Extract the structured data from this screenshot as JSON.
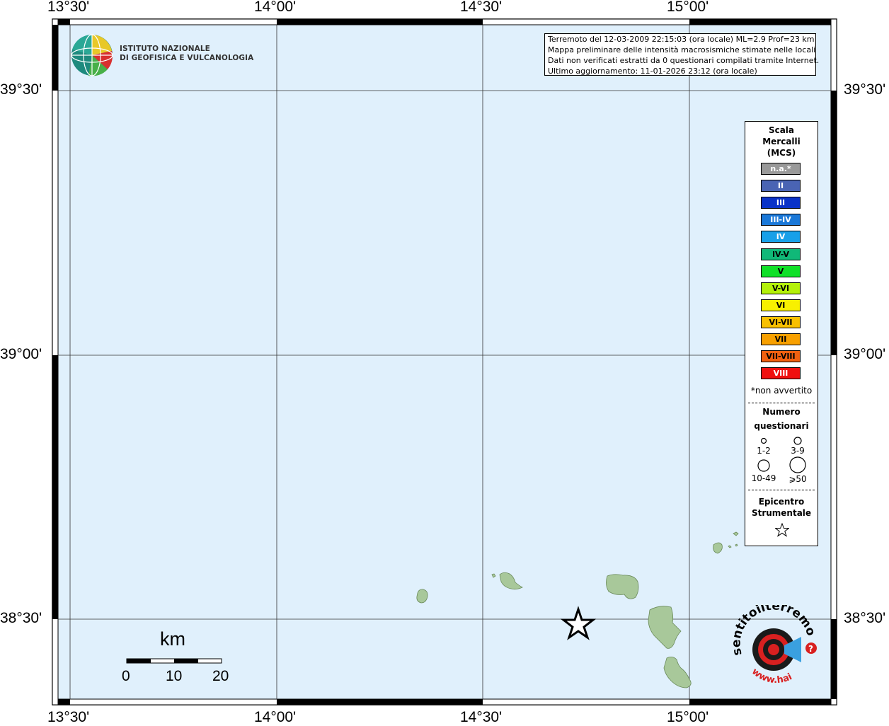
{
  "map": {
    "lon_ticks": [
      "13°30'",
      "14°00'",
      "14°30'",
      "15°00'"
    ],
    "lat_ticks": [
      "39°30'",
      "39°00'",
      "38°30'"
    ]
  },
  "header": {
    "logo_line1": "ISTITUTO NAZIONALE",
    "logo_line2": "DI GEOFISICA E VULCANOLOGIA"
  },
  "info": {
    "line1": "Terremoto del 12-03-2009 22:15:03 (ora locale) ML=2.9 Prof=23 km",
    "line2": "Mappa preliminare delle intensità macrosismiche stimate nelle località",
    "line3": "Dati non verificati estratti da 0 questionari compilati tramite Internet.",
    "line4": "Ultimo aggiornamento: 11-01-2026 23:12 (ora locale)"
  },
  "legend": {
    "title1": "Scala",
    "title2": "Mercalli",
    "title3": "(MCS)",
    "classes": [
      {
        "label": "n.a.*",
        "color": "#999999",
        "text": "#ffffff"
      },
      {
        "label": "II",
        "color": "#4a64b4",
        "text": "#ffffff"
      },
      {
        "label": "III",
        "color": "#0a32c8",
        "text": "#ffffff"
      },
      {
        "label": "III-IV",
        "color": "#1a78d8",
        "text": "#ffffff"
      },
      {
        "label": "IV",
        "color": "#18a0e8",
        "text": "#ffffff"
      },
      {
        "label": "IV-V",
        "color": "#10b878",
        "text": "#000000"
      },
      {
        "label": "V",
        "color": "#10e028",
        "text": "#000000"
      },
      {
        "label": "V-VI",
        "color": "#b4f00a",
        "text": "#000000"
      },
      {
        "label": "VI",
        "color": "#f8f000",
        "text": "#000000"
      },
      {
        "label": "VI-VII",
        "color": "#f8c000",
        "text": "#000000"
      },
      {
        "label": "VII",
        "color": "#f8a000",
        "text": "#000000"
      },
      {
        "label": "VII-VIII",
        "color": "#f06010",
        "text": "#000000"
      },
      {
        "label": "VIII",
        "color": "#f01010",
        "text": "#ffffff"
      }
    ],
    "not_felt_note": "*non avvertito",
    "count_title1": "Numero",
    "count_title2": "questionari",
    "count_1": "1-2",
    "count_2": "3-9",
    "count_3": "10-49",
    "count_4": "⩾50",
    "epicenter_title1": "Epicentro",
    "epicenter_title2": "Strumentale"
  },
  "scale_bar": {
    "unit": "km",
    "labels": [
      "0",
      "10",
      "20"
    ]
  },
  "badge": {
    "top_text": "sentitoilterremoto.it",
    "bottom_text": "www.hai",
    "question": "?"
  },
  "colors": {
    "sea": "#e0f0fc",
    "land": "#a8c89a",
    "frame": "#000000"
  }
}
